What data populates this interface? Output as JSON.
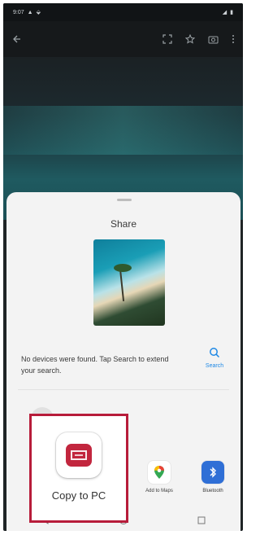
{
  "status_bar": {
    "time": "9:07"
  },
  "share_sheet": {
    "title": "Share",
    "no_devices_text": "No devices were found. Tap Search to extend your search.",
    "search_label": "Search",
    "apps": [
      {
        "label": "Add to Maps",
        "icon": "maps-pin-icon"
      },
      {
        "label": "Bluetooth",
        "icon": "bluetooth-icon"
      }
    ],
    "highlighted_app": {
      "label": "Copy to PC",
      "icon": "copy-to-pc-icon",
      "highlight_color": "#b71c3a"
    }
  },
  "colors": {
    "accent": "#1e88e5",
    "sheet_bg": "#f3f3f3",
    "screen_bg": "#1f2426"
  }
}
